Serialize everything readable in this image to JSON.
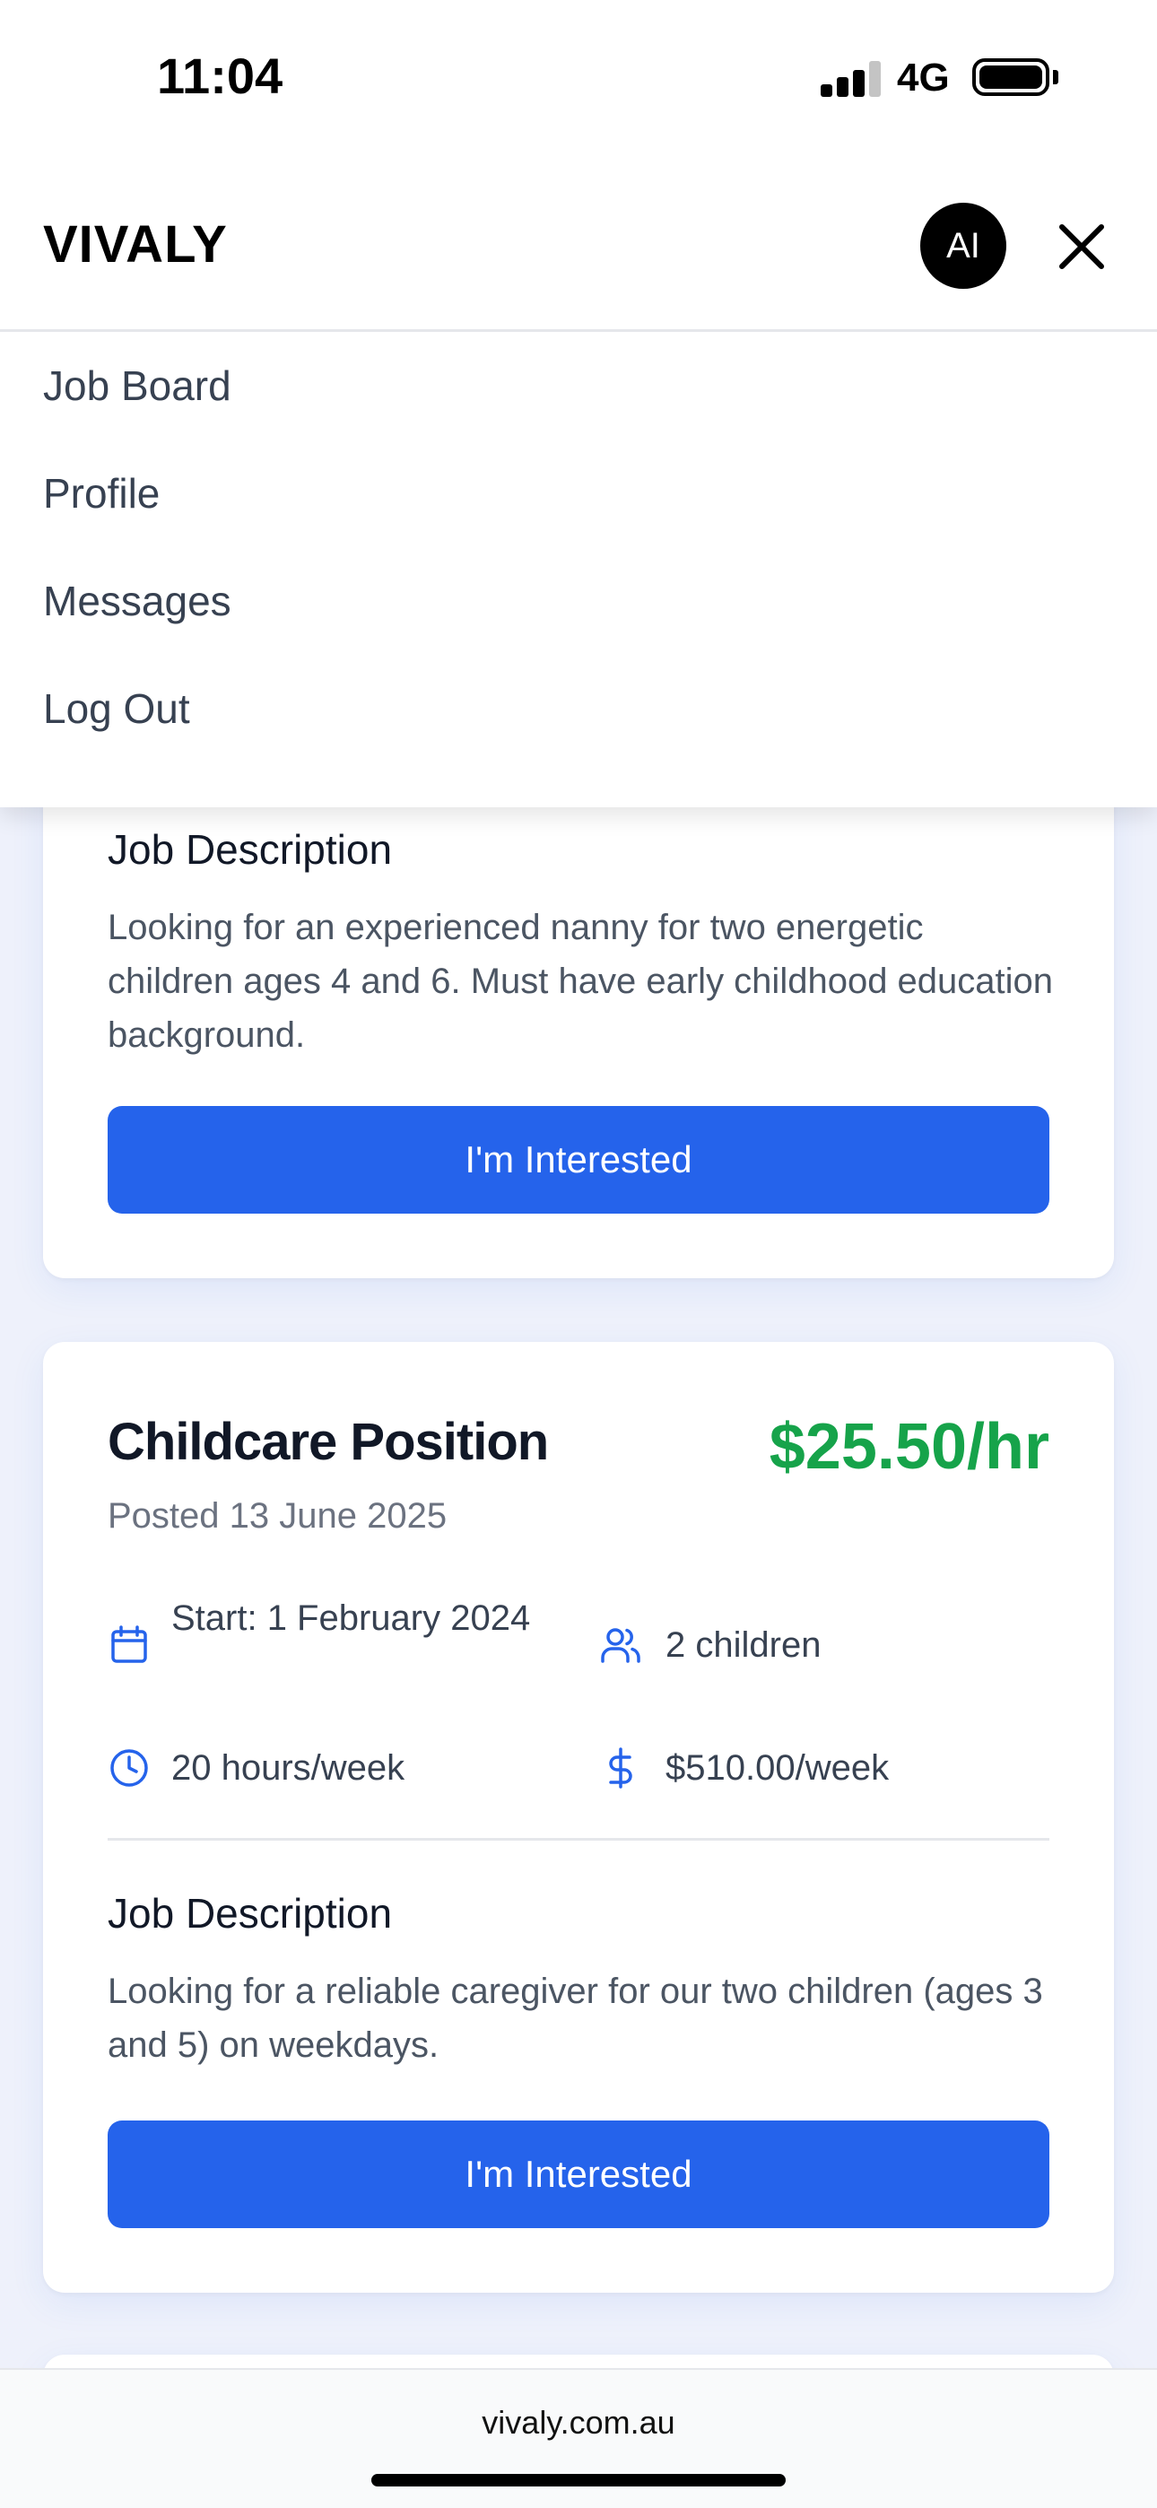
{
  "status_bar": {
    "time": "11:04",
    "network": "4G"
  },
  "header": {
    "brand": "VIVALY",
    "avatar_initials": "AI"
  },
  "menu": {
    "items": [
      {
        "label": "Job Board"
      },
      {
        "label": "Profile"
      },
      {
        "label": "Messages"
      },
      {
        "label": "Log Out"
      }
    ]
  },
  "jobs": [
    {
      "description_title": "Job Description",
      "description": "Looking for an experienced nanny for two energetic children ages 4 and 6. Must have early childhood education background.",
      "button_label": "I'm Interested"
    },
    {
      "title": "Childcare Position",
      "rate": "$25.50/hr",
      "posted": "Posted 13 June 2025",
      "start": "Start: 1 February 2024",
      "children": "2 children",
      "hours": "20 hours/week",
      "weekly_pay": "$510.00/week",
      "description_title": "Job Description",
      "description": "Looking for a reliable caregiver for our two children (ages 3 and 5) on weekdays.",
      "button_label": "I'm Interested"
    }
  ],
  "browser": {
    "url": "vivaly.com.au"
  },
  "colors": {
    "accent": "#2563eb",
    "rate": "#16a34a",
    "background": "#eef1fb"
  }
}
